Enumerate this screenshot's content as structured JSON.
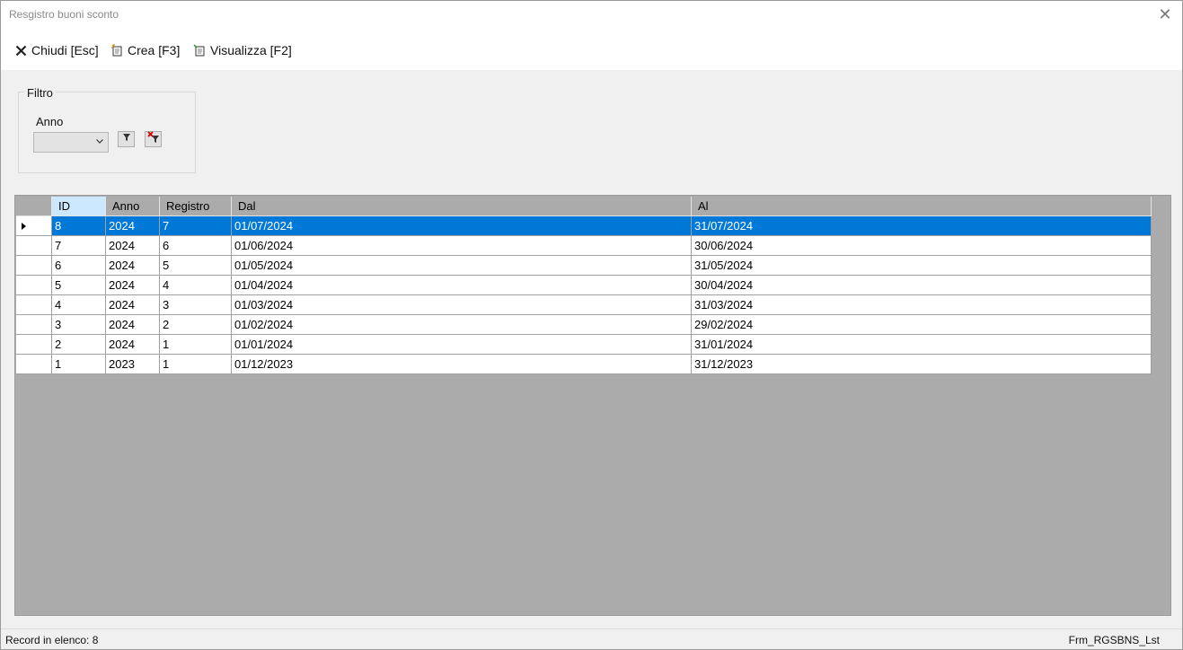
{
  "window": {
    "title": "Resgistro buoni sconto"
  },
  "toolbar": {
    "close_label": "Chiudi [Esc]",
    "create_label": "Crea [F3]",
    "view_label": "Visualizza [F2]"
  },
  "filter": {
    "group_label": "Filtro",
    "year_label": "Anno",
    "year_value": ""
  },
  "grid": {
    "columns": [
      "ID",
      "Anno",
      "Registro",
      "Dal",
      "Al"
    ],
    "rows": [
      [
        "8",
        "2024",
        "7",
        "01/07/2024",
        "31/07/2024"
      ],
      [
        "7",
        "2024",
        "6",
        "01/06/2024",
        "30/06/2024"
      ],
      [
        "6",
        "2024",
        "5",
        "01/05/2024",
        "31/05/2024"
      ],
      [
        "5",
        "2024",
        "4",
        "01/04/2024",
        "30/04/2024"
      ],
      [
        "4",
        "2024",
        "3",
        "01/03/2024",
        "31/03/2024"
      ],
      [
        "3",
        "2024",
        "2",
        "01/02/2024",
        "29/02/2024"
      ],
      [
        "2",
        "2024",
        "1",
        "01/01/2024",
        "31/01/2024"
      ],
      [
        "1",
        "2023",
        "1",
        "01/12/2023",
        "31/12/2023"
      ]
    ],
    "selected_row_id": "8"
  },
  "status": {
    "record_count": "Record in elenco: 8",
    "form_name": "Frm_RGSBNS_Lst"
  },
  "colors": {
    "selection": "#0078d7",
    "header_selected": "#cce8ff",
    "grid_background": "#ababab"
  }
}
